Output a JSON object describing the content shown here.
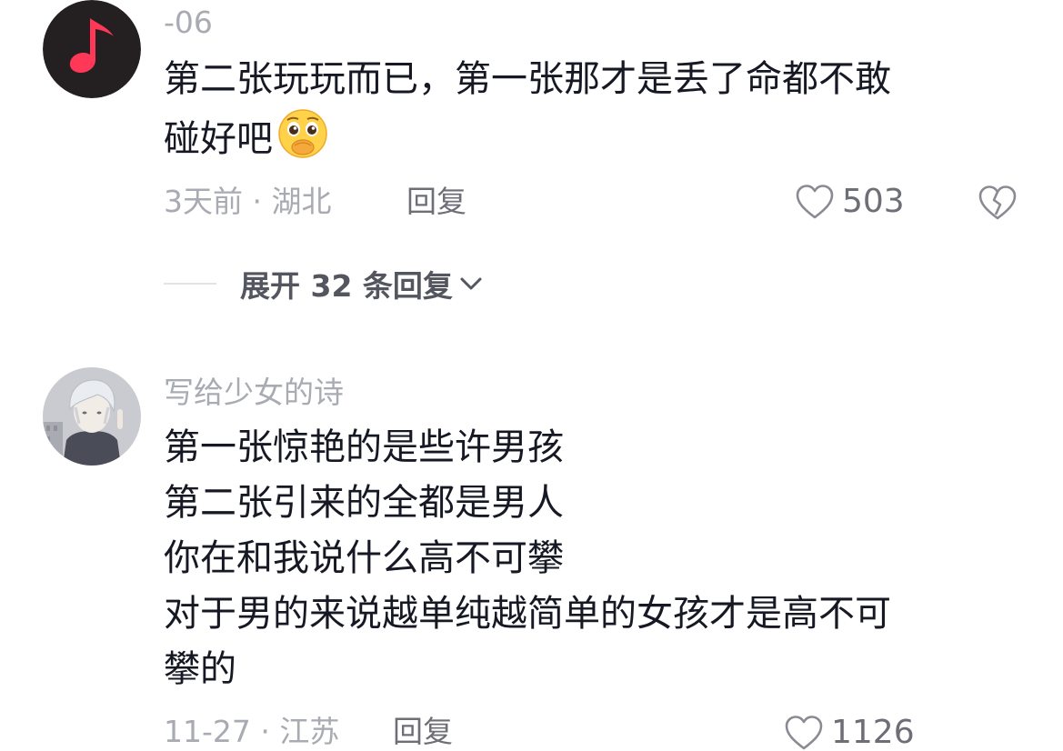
{
  "comments": [
    {
      "username": "-06",
      "lines": [
        "第二张玩玩而已，第一张那才是丢了命都不敢",
        "碰好吧"
      ],
      "emoji": "crying-pleading-emoji",
      "time_location": "3天前 · 湖北",
      "reply_label": "回复",
      "like_count": "503"
    },
    {
      "username": "写给少女的诗",
      "lines": [
        "第一张惊艳的是些许男孩",
        "第二张引来的全都是男人",
        "你在和我说什么高不可攀",
        "对于男的来说越单纯越简单的女孩才是高不可",
        "攀的"
      ],
      "time_location": "11-27 · 江苏",
      "reply_label": "回复",
      "like_count": "1126"
    }
  ],
  "expand_replies": {
    "label": "展开 32 条回复"
  },
  "colors": {
    "primary_text": "#161823",
    "secondary_text": "#a9abb2",
    "action_text": "#6d6e76",
    "avatar1_bg": "#2a2426",
    "avatar1_note": "#ff3b5c"
  }
}
